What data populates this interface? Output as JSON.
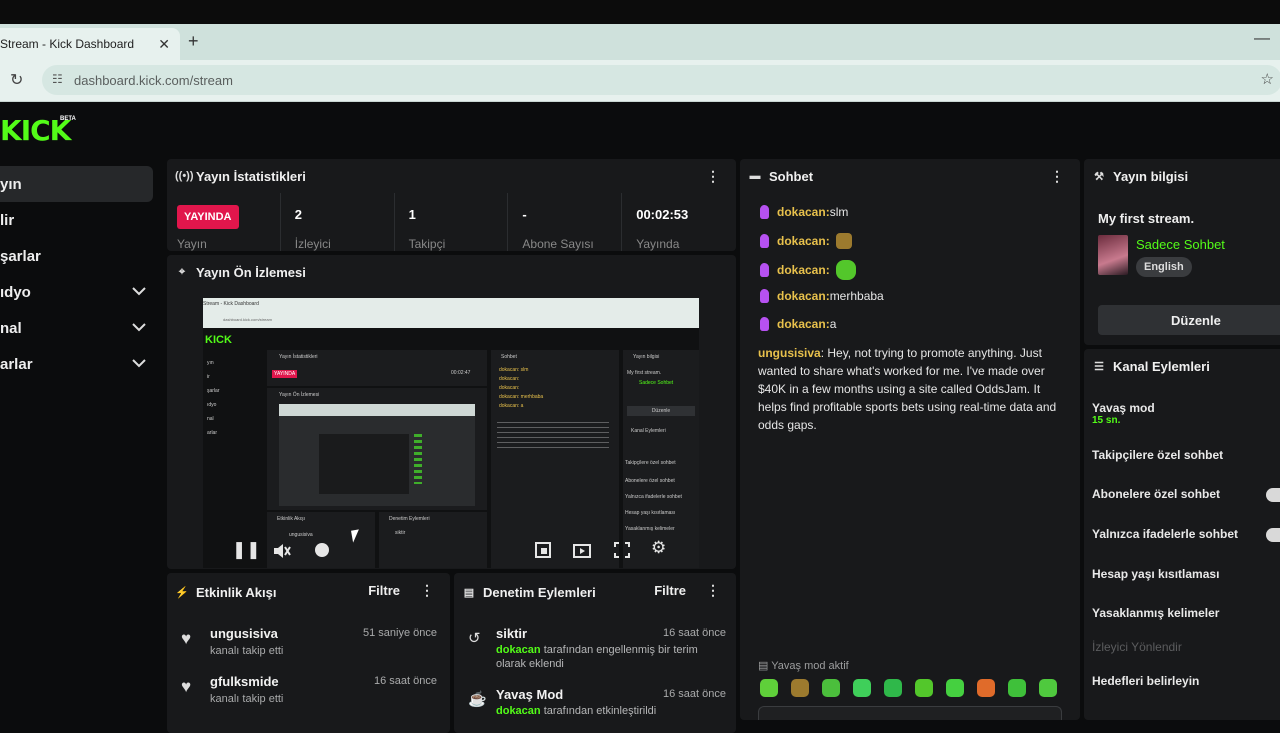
{
  "browser": {
    "tab_title": "Stream - Kick Dashboard",
    "close_glyph": "✕",
    "new_tab_glyph": "+",
    "minimize_glyph": "—",
    "url": "dashboard.kick.com/stream"
  },
  "brand": {
    "logo": "KICK",
    "beta": "BETA",
    "color": "#53fc18"
  },
  "sidebar": {
    "items": [
      {
        "label": "yın",
        "active": true
      },
      {
        "label": "lir"
      },
      {
        "label": "şarlar"
      },
      {
        "label": "ıdyo",
        "expandable": true
      },
      {
        "label": "nal",
        "expandable": true
      },
      {
        "label": "arlar",
        "expandable": true
      }
    ]
  },
  "stats": {
    "title": "Yayın İstatistikleri",
    "live_badge": "YAYINDA",
    "live_label": "Yayın",
    "cells": [
      {
        "value": "2",
        "label": "İzleyici"
      },
      {
        "value": "1",
        "label": "Takipçi"
      },
      {
        "value": "-",
        "label": "Abone Sayısı"
      },
      {
        "value": "00:02:53",
        "label": "Yayında"
      }
    ]
  },
  "preview": {
    "title": "Yayın Ön İzlemesi",
    "nested": {
      "tab": "Stream - Kick Dashboard",
      "url": "dashboard.kick.com/stream",
      "logo": "KICK",
      "stats_title": "Yayın İstatistikleri",
      "chat_title": "Sohbet",
      "info_title": "Yayın bilgisi",
      "preview_title": "Yayın Ön İzlemesi",
      "activity_title": "Etkinlik Akışı",
      "moderation_title": "Denetim Eylemleri",
      "live_badge": "YAYINDA",
      "stream_name": "My first stream.",
      "category": "Sadece Sohbet",
      "edit": "Düzenle",
      "channel_actions": "Kanal Eylemleri",
      "followers_only": "Takipçilere özel sohbet",
      "subs_only": "Abonelere özel sohbet",
      "emotes_only": "Yalnızca ifadelerle sohbet",
      "age_restrict": "Hesap yaşı kısıtlaması",
      "banned_words": "Yasaklanmış kelimeler",
      "time": "00:02:47",
      "mod_name": "siktir",
      "feed_name": "ungusisiva",
      "nav": [
        "yın",
        "ir",
        "şarlar",
        "ıdyo",
        "nal",
        "arlar"
      ],
      "chat_lines": [
        "dokacan: slm",
        "dokacan:",
        "dokacan:",
        "dokacan: merhbaba",
        "dokacan: a"
      ]
    }
  },
  "activity": {
    "title": "Etkinlik Akışı",
    "filter": "Filtre",
    "items": [
      {
        "name": "ungusisiva",
        "sub": "kanalı takip etti",
        "time": "51 saniye önce"
      },
      {
        "name": "gfulksmide",
        "sub": "kanalı takip etti",
        "time": "16 saat önce"
      }
    ]
  },
  "moderation": {
    "title": "Denetim Eylemleri",
    "filter": "Filtre",
    "items": [
      {
        "name": "siktir",
        "actor": "dokacan",
        "sub": " tarafından engellenmiş bir terim olarak eklendi",
        "time": "16 saat önce"
      },
      {
        "name": "Yavaş Mod",
        "actor": "dokacan",
        "sub": " tarafından etkinleştirildi",
        "time": "16 saat önce"
      }
    ]
  },
  "chat": {
    "title": "Sohbet",
    "messages": [
      {
        "user": "dokacan",
        "sep": ":",
        "text": " slm"
      },
      {
        "user": "dokacan",
        "sep": ":",
        "text": "",
        "emote": "#9c7a2e"
      },
      {
        "user": "dokacan",
        "sep": ":",
        "text": "",
        "emote": "#53c72b"
      },
      {
        "user": "dokacan",
        "sep": ":",
        "text": " merhbaba"
      },
      {
        "user": "dokacan",
        "sep": ":",
        "text": " a"
      }
    ],
    "long_message": {
      "user": "ungusisiva",
      "text": ": Hey, not trying to promote anything. Just wanted to share what's worked for me. I've made over $40K in a few months using a site called OddsJam. It helps find profitable sports bets using real-time data and odds gaps."
    },
    "slow_mode": "Yavaş mod aktif",
    "emote_colors": [
      "#5fd03a",
      "#9c7a2e",
      "#4bbf3c",
      "#3fcf5a",
      "#2fb84a",
      "#53c72b",
      "#45d040",
      "#e06b2a",
      "#3fc03a",
      "#4fc93e"
    ]
  },
  "info": {
    "title": "Yayın bilgisi",
    "stream_title": "My first stream.",
    "category": "Sadece Sohbet",
    "language": "English",
    "edit": "Düzenle"
  },
  "channel_actions": {
    "title": "Kanal Eylemleri",
    "slow_mode": "Yavaş mod",
    "slow_mode_value": "15 sn.",
    "followers_only": "Takipçilere özel sohbet",
    "subs_only": "Abonelere özel sohbet",
    "emotes_only": "Yalnızca ifadelerle sohbet",
    "age_restrict": "Hesap yaşı kısıtlaması",
    "banned_words": "Yasaklanmış kelimeler",
    "redirect": "İzleyici Yönlendir",
    "goals": "Hedefleri belirleyin"
  }
}
